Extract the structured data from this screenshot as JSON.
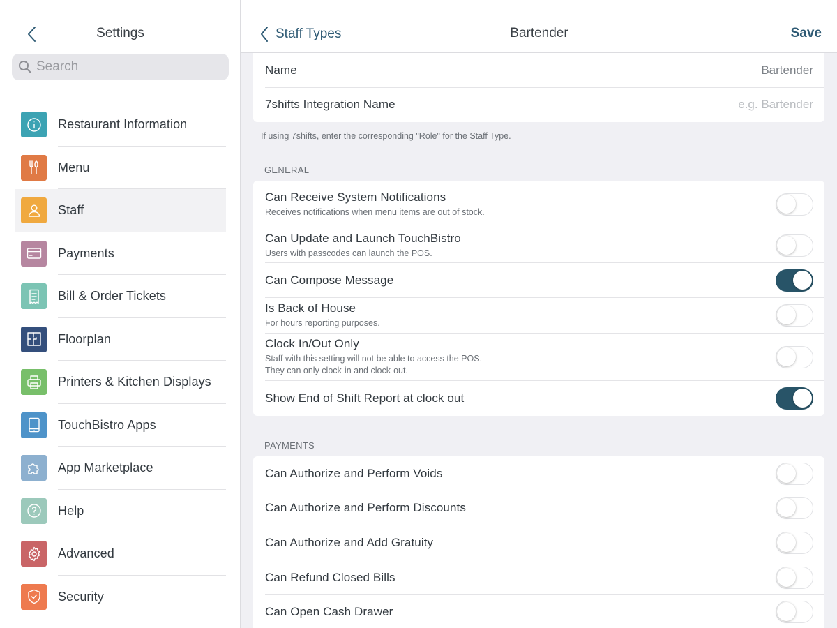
{
  "sidebar": {
    "title": "Settings",
    "back_icon": "chevron-left-icon",
    "search": {
      "placeholder": "Search",
      "value": ""
    },
    "items": [
      {
        "label": "Restaurant Information",
        "icon": "info-icon",
        "color": "#3ca3b3",
        "active": false
      },
      {
        "label": "Menu",
        "icon": "utensils-icon",
        "color": "#e07a45",
        "active": false
      },
      {
        "label": "Staff",
        "icon": "user-icon",
        "color": "#f0a93f",
        "active": true
      },
      {
        "label": "Payments",
        "icon": "credit-card-icon",
        "color": "#b686a0",
        "active": false
      },
      {
        "label": "Bill & Order Tickets",
        "icon": "receipt-icon",
        "color": "#7cc4b4",
        "active": false
      },
      {
        "label": "Floorplan",
        "icon": "floorplan-icon",
        "color": "#344f7c",
        "active": false
      },
      {
        "label": "Printers & Kitchen Displays",
        "icon": "printer-icon",
        "color": "#78bf6a",
        "active": false
      },
      {
        "label": "TouchBistro Apps",
        "icon": "tablet-icon",
        "color": "#4e93c9",
        "active": false
      },
      {
        "label": "App Marketplace",
        "icon": "puzzle-icon",
        "color": "#8db0cf",
        "active": false
      },
      {
        "label": "Help",
        "icon": "help-icon",
        "color": "#9cc9bb",
        "active": false
      },
      {
        "label": "Advanced",
        "icon": "gear-icon",
        "color": "#c96567",
        "active": false
      },
      {
        "label": "Security",
        "icon": "shield-icon",
        "color": "#ee7a4f",
        "active": false
      }
    ]
  },
  "navbar": {
    "back_label": "Staff Types",
    "title": "Bartender",
    "save_label": "Save"
  },
  "identity": {
    "name_label": "Name",
    "name_value": "Bartender",
    "integration_label": "7shifts Integration Name",
    "integration_value": "",
    "integration_placeholder": "e.g. Bartender",
    "footnote": "If using 7shifts, enter the corresponding \"Role\" for the Staff Type."
  },
  "general": {
    "title": "GENERAL",
    "rows": [
      {
        "label": "Can Receive System Notifications",
        "sub": "Receives notifications when menu items are out of stock.",
        "on": false
      },
      {
        "label": "Can Update and Launch TouchBistro",
        "sub": "Users with passcodes can launch the POS.",
        "on": false
      },
      {
        "label": "Can Compose Message",
        "sub": "",
        "on": true
      },
      {
        "label": "Is Back of House",
        "sub": "For hours reporting purposes.",
        "on": false
      },
      {
        "label": "Clock In/Out Only",
        "sub": "Staff with this setting will not be able to access the POS. They can only clock-in and clock-out.",
        "on": false
      },
      {
        "label": "Show End of Shift Report at clock out",
        "sub": "",
        "on": true
      }
    ]
  },
  "payments": {
    "title": "PAYMENTS",
    "rows": [
      {
        "label": "Can Authorize and Perform Voids",
        "on": false
      },
      {
        "label": "Can Authorize and Perform Discounts",
        "on": false
      },
      {
        "label": "Can Authorize and Add Gratuity",
        "on": false
      },
      {
        "label": "Can Refund Closed Bills",
        "on": false
      },
      {
        "label": "Can Open Cash Drawer",
        "on": false
      }
    ]
  },
  "colors": {
    "accent": "#2e5a74",
    "toggle_on": "#285468"
  }
}
